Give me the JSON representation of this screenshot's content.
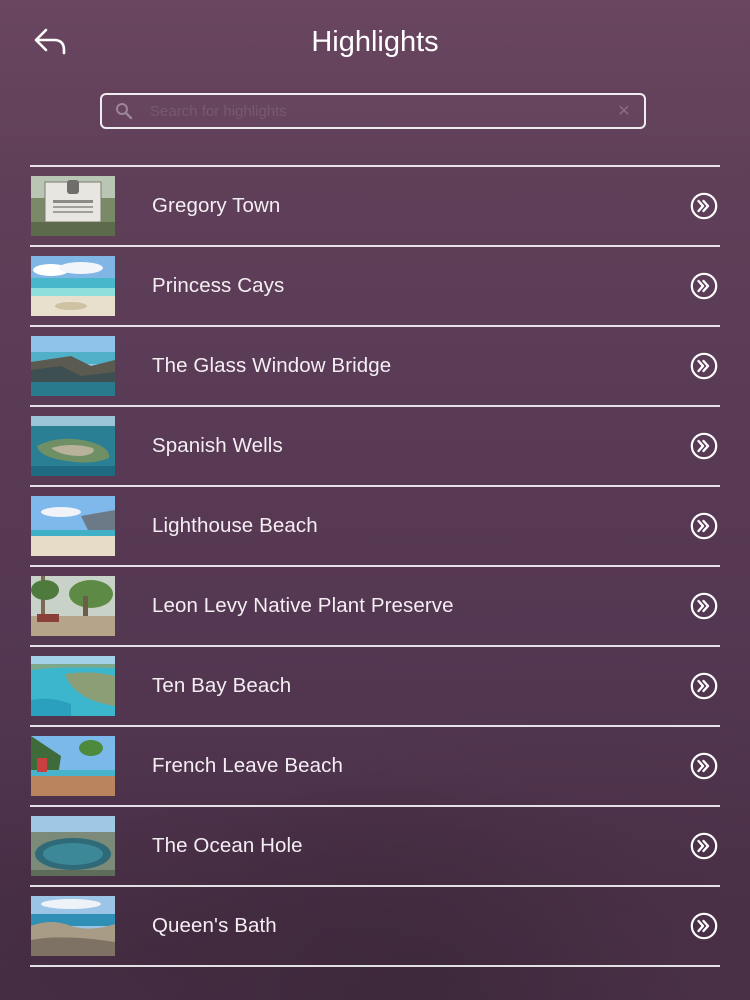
{
  "header": {
    "title": "Highlights",
    "back_icon": "back-arrow-icon"
  },
  "search": {
    "placeholder": "Search for highlights",
    "value": "",
    "search_icon": "search-icon",
    "clear_icon": "clear-icon"
  },
  "list": {
    "items": [
      {
        "label": "Gregory Town",
        "thumb": "sign"
      },
      {
        "label": "Princess Cays",
        "thumb": "beach"
      },
      {
        "label": "The Glass Window Bridge",
        "thumb": "cliff"
      },
      {
        "label": "Spanish Wells",
        "thumb": "island"
      },
      {
        "label": "Lighthouse Beach",
        "thumb": "shore"
      },
      {
        "label": "Leon Levy Native Plant Preserve",
        "thumb": "garden"
      },
      {
        "label": "Ten Bay Beach",
        "thumb": "bay"
      },
      {
        "label": "French Leave Beach",
        "thumb": "resort"
      },
      {
        "label": "The Ocean Hole",
        "thumb": "hole"
      },
      {
        "label": "Queen's Bath",
        "thumb": "rocks"
      }
    ],
    "row_icon": "chevron-double-right-icon"
  },
  "colors": {
    "background": "#5a3b55",
    "text": "#ffffff",
    "divider": "#ffffff"
  }
}
